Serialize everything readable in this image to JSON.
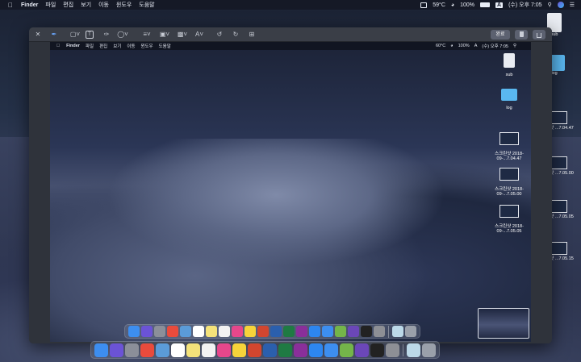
{
  "menubar": {
    "apple": "",
    "app_name": "Finder",
    "items": [
      "파일",
      "편집",
      "보기",
      "이동",
      "윈도우",
      "도움말"
    ],
    "temp": "59°C",
    "battery": "100%",
    "input": "A",
    "clock": "(수) 오후 7:05"
  },
  "inner_menubar": {
    "app_name": "Finder",
    "items": [
      "파일",
      "편집",
      "보기",
      "이동",
      "윈도우",
      "도움말"
    ],
    "temp": "60°C",
    "battery": "100%",
    "input": "A",
    "clock": "(수) 오후 7:05"
  },
  "toolbar": {
    "done_label": "완료",
    "text_tool": "T",
    "font_tool": "A"
  },
  "desktop_icons": [
    {
      "label": "sub"
    },
    {
      "label": "log"
    },
    {
      "label": "스크린샷 2018-09-...7.04.47"
    },
    {
      "label": "스크린샷 2018-09-...7.05.00"
    },
    {
      "label": "스크린샷 2018-09-...7.05.05"
    }
  ],
  "outer_icons": [
    {
      "label": "sub"
    },
    {
      "label": "log"
    },
    {
      "label": "크린샷 ...7.04.47"
    },
    {
      "label": "크린샷 ...7.05.00"
    },
    {
      "label": "크린샷 ...7.05.05"
    },
    {
      "label": "크린샷 ...7.05.15"
    }
  ],
  "dock_apps": [
    "finder",
    "siri",
    "launchpad",
    "chrome",
    "preview",
    "calendar",
    "notes",
    "reminders",
    "itunes",
    "kakaotalk",
    "powerpoint",
    "word",
    "excel",
    "onenote",
    "app-store",
    "xcode",
    "android-studio",
    "terminal-alt",
    "terminal",
    "system-preferences",
    "downloads",
    "trash"
  ],
  "dock_colors": [
    "#3d8ef0",
    "#6b53d6",
    "#8b8f99",
    "#e94b3c",
    "#5b9bd8",
    "#ffffff",
    "#f4e27a",
    "#f2f2f2",
    "#e6478b",
    "#f6d33a",
    "#d2462f",
    "#2b5fad",
    "#1f7a43",
    "#8a2f9a",
    "#2d86f0",
    "#3d8ef0",
    "#74b54a",
    "#6b47b8",
    "#222222",
    "#8d8f95",
    "#bcd9e8",
    "#9aa0aa"
  ]
}
